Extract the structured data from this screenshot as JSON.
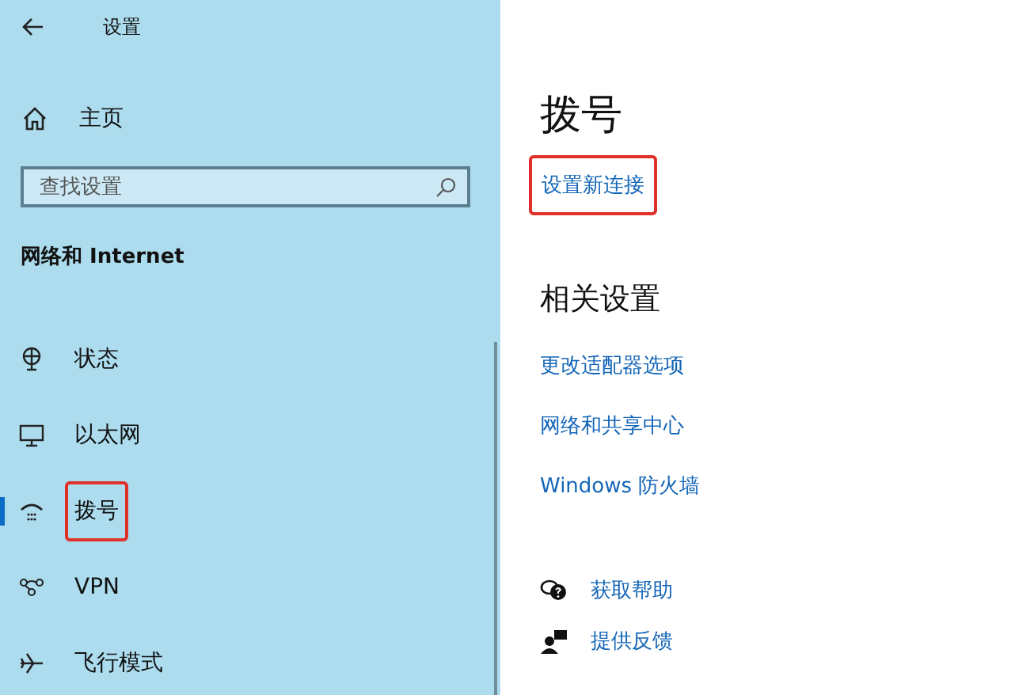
{
  "window": {
    "title": "设置"
  },
  "sidebar": {
    "home": "主页",
    "search": {
      "placeholder": "查找设置"
    },
    "section": "网络和 Internet",
    "items": [
      {
        "label": "状态",
        "selected": false,
        "highlighted": false
      },
      {
        "label": "以太网",
        "selected": false,
        "highlighted": false
      },
      {
        "label": "拨号",
        "selected": true,
        "highlighted": true
      },
      {
        "label": "VPN",
        "selected": false,
        "highlighted": false
      },
      {
        "label": "飞行模式",
        "selected": false,
        "highlighted": false
      }
    ]
  },
  "main": {
    "heading": "拨号",
    "action": {
      "label": "设置新连接",
      "highlighted": true
    },
    "related_heading": "相关设置",
    "related_links": [
      "更改适配器选项",
      "网络和共享中心",
      "Windows 防火墙"
    ],
    "help_links": [
      "获取帮助",
      "提供反馈"
    ]
  }
}
